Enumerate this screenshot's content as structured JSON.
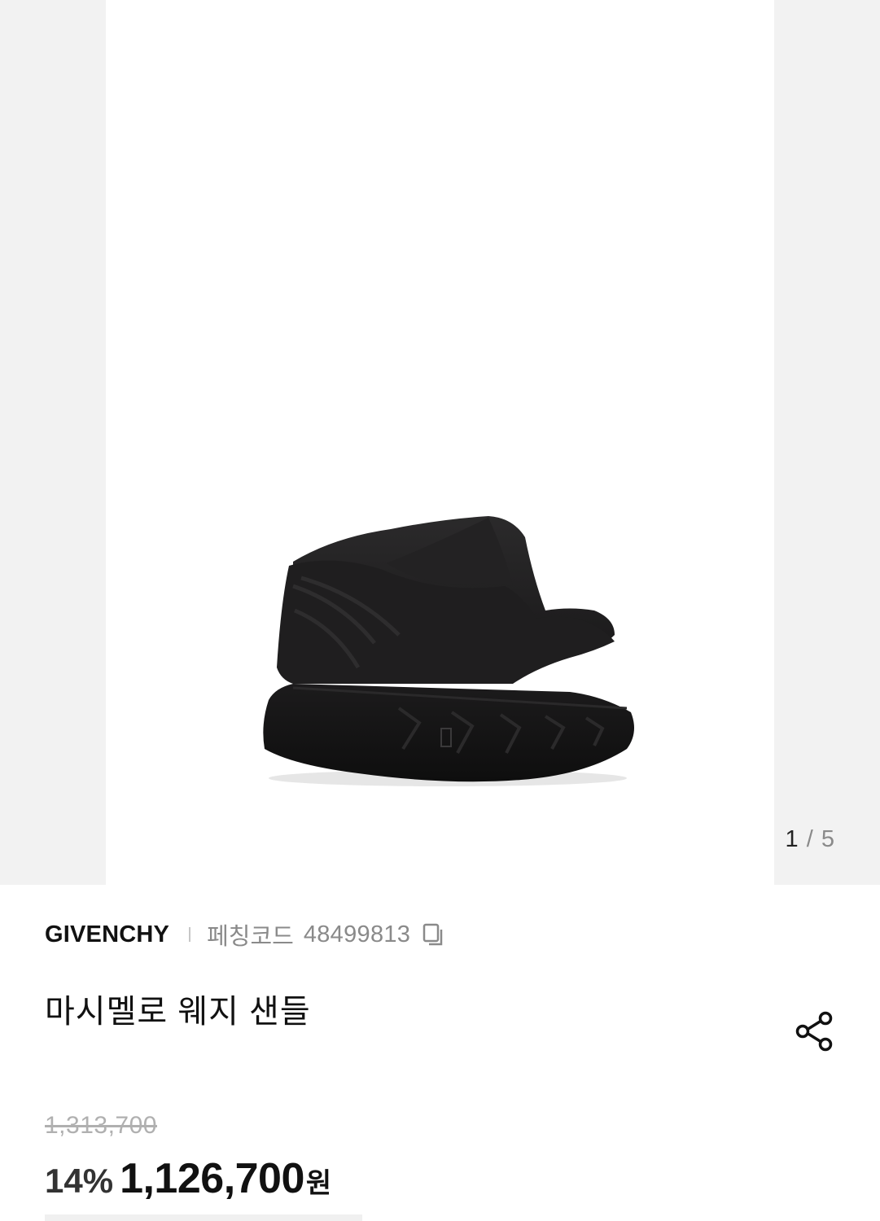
{
  "carousel": {
    "current": "1",
    "separator": "/",
    "total": "5"
  },
  "product": {
    "brand": "GIVENCHY",
    "code_label": "페칭코드",
    "code_value": "48499813",
    "title": "마시멜로 웨지 샌들",
    "image_icon": "product-photo-black-wedge-sandal"
  },
  "price": {
    "original": "1,313,700",
    "discount_rate": "14%",
    "sale": "1,126,700",
    "currency": "원"
  },
  "icons": {
    "copy": "copy-icon",
    "share": "share-icon"
  },
  "colors": {
    "text_primary": "#111111",
    "text_secondary": "#8a8a8a",
    "strikethrough": "#b0b0b0",
    "image_backdrop": "#f2f2f2"
  }
}
